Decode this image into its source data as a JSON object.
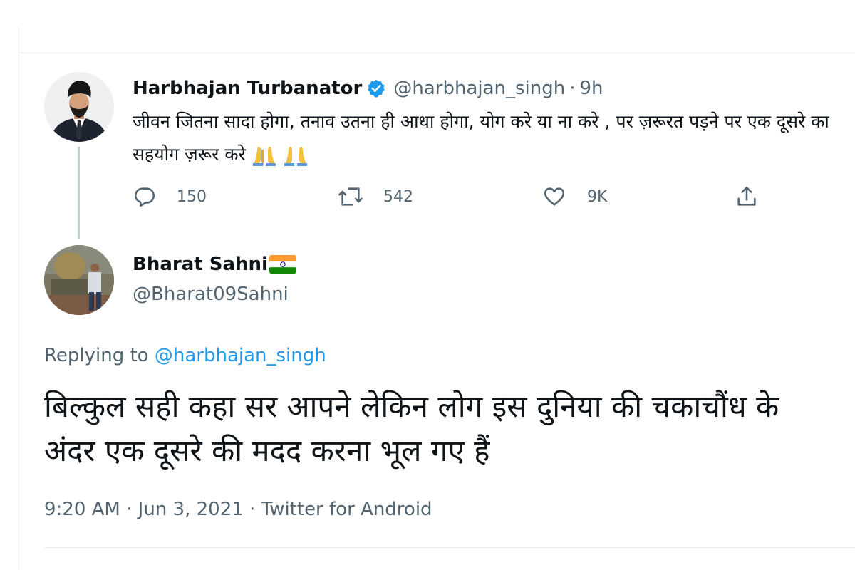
{
  "thread": {
    "tweet_1": {
      "author_name": "Harbhajan Turbanator",
      "verified": true,
      "handle": "@harbhajan_singh",
      "separator": "·",
      "time": "9h",
      "text": "जीवन जितना सादा होगा, तनाव उतना ही आधा होगा, योग करे या ना करे , पर ज़रूरत पड़ने पर एक दूसरे का सहयोग ज़रूर करे",
      "emojis": "🙏🙏",
      "actions": {
        "reply_count": "150",
        "retweet_count": "542",
        "like_count": "9K"
      }
    },
    "tweet_2": {
      "author_name": "Bharat Sahni",
      "flag_icon": "india-flag-icon",
      "handle": "@Bharat09Sahni",
      "replying_prefix": "Replying to",
      "replying_to": "@harbhajan_singh",
      "text": "बिल्कुल सही कहा सर आपने लेकिन लोग इस दुनिया की चकाचौंध के अंदर एक दूसरे की मदद करना भूल गए हैं",
      "time": "9:20 AM",
      "separator": "·",
      "date": "Jun 3, 2021",
      "source": "Twitter for Android"
    }
  },
  "colors": {
    "text_primary": "#0f1419",
    "text_secondary": "#536471",
    "accent": "#1d9bf0",
    "divider": "#e6ecf0",
    "thread_line": "#c4cfd6"
  },
  "icons": {
    "reply": "speech-bubble-icon",
    "retweet": "retweet-icon",
    "like": "heart-icon",
    "share": "share-icon",
    "verified": "verified-badge-icon",
    "emoji": "folded-hands-emoji"
  }
}
